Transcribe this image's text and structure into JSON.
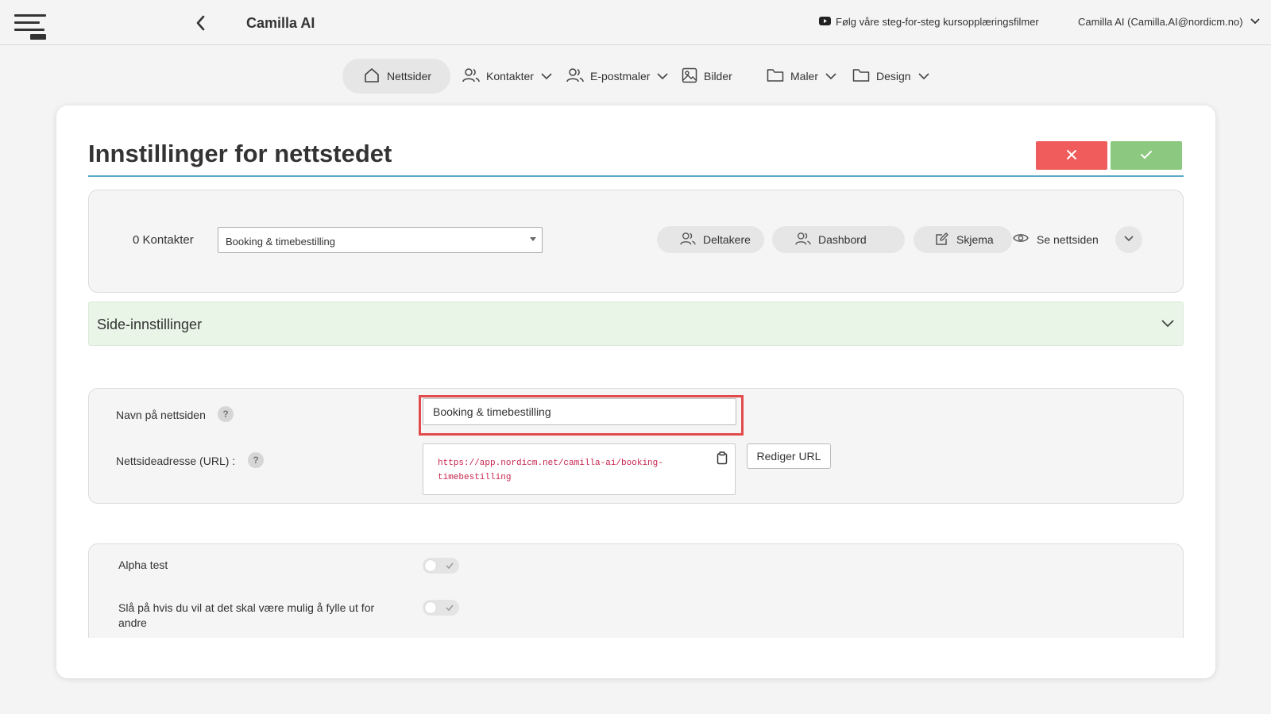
{
  "header": {
    "app_title": "Camilla AI",
    "tutorial_link": "Følg våre steg-for-steg kursopplæringsfilmer",
    "user": "Camilla AI (Camilla.AI@nordicm.no)"
  },
  "nav": {
    "items": [
      {
        "label": "Nettsider",
        "icon": "home-icon",
        "active": true,
        "dropdown": false
      },
      {
        "label": "Kontakter",
        "icon": "users-icon",
        "dropdown": true
      },
      {
        "label": "E-postmaler",
        "icon": "users-icon",
        "dropdown": true
      },
      {
        "label": "Bilder",
        "icon": "image-icon",
        "dropdown": false
      },
      {
        "label": "Maler",
        "icon": "folder-icon",
        "dropdown": true
      },
      {
        "label": "Design",
        "icon": "folder-icon",
        "dropdown": true
      }
    ]
  },
  "page": {
    "title": "Innstillinger for nettstedet"
  },
  "toolbar": {
    "contacts_count": "0 Kontakter",
    "selected_site": "Booking & timebestilling",
    "participants": "Deltakere",
    "dashboard": "Dashbord",
    "form": "Skjema",
    "view_site": "Se nettsiden"
  },
  "accordion": {
    "title": "Side-innstillinger"
  },
  "settings": {
    "name_label": "Navn på nettsiden",
    "name_value": "Booking & timebestilling",
    "url_label": "Nettsideadresse (URL) :",
    "url_value": "https://app.nordicm.net/camilla-ai/booking-timebestilling",
    "edit_url": "Rediger URL",
    "help_glyph": "?"
  },
  "toggles": {
    "alpha_label": "Alpha test",
    "alpha_on": false,
    "fill_for_others_label": "Slå på hvis du vil at det skal være mulig å fylle ut for andre",
    "fill_for_others_on": false
  },
  "colors": {
    "cancel": "#f05b5b",
    "confirm": "#8cc87f",
    "title_rule": "#5aa9c8",
    "highlight": "#e24b4b",
    "url": "#c7254e"
  }
}
